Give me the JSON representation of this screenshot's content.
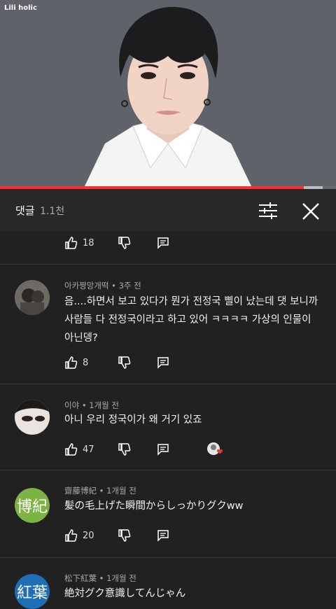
{
  "video": {
    "channel_label": "Lili holic",
    "progress_fraction": 0.905,
    "buffer_fraction": 0.96
  },
  "header": {
    "title": "댓글",
    "count": "1.1천"
  },
  "top_partial": {
    "likes": "18"
  },
  "comments": [
    {
      "author_meta": "아카짱망개떡 • 3주 전",
      "text": "음....하면서 보고 있다가 뭔가 전정국 삘이 났는데 댓 보니까 사람들 다 전정국이라고 하고 있어 ㅋㅋㅋㅋ 가상의 인물이 아닌뎅?",
      "likes": "8"
    },
    {
      "author_meta": "이야 • 1개월 전",
      "text": "아니 우리 정국이가 왜 거기 있죠",
      "likes": "47",
      "hearted": true
    },
    {
      "author_meta": "齋藤博紀 • 1개월 전",
      "text": "髪の毛上げた瞬間からしっかりグクww",
      "likes": "20",
      "avatar_text": "博紀",
      "avatar_color": "#7cb342"
    },
    {
      "author_meta": "松下紅葉 • 1개월 전",
      "text": "絶対グク意識してんじゃん",
      "avatar_text": "紅葉",
      "avatar_color": "#1e6fb8"
    }
  ],
  "colors": {
    "background": "#212121",
    "progress": "#ff2d2d",
    "heart": "#e53935"
  }
}
